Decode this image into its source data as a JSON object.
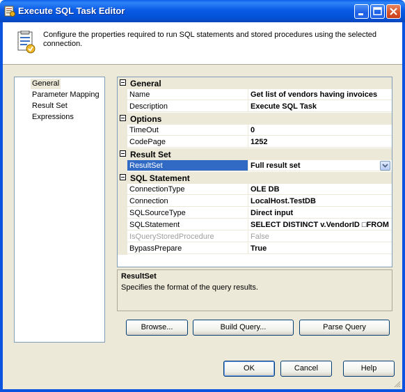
{
  "window": {
    "title": "Execute SQL Task Editor"
  },
  "header": {
    "description": "Configure the properties required to run SQL statements and stored procedures using the selected connection."
  },
  "nav": {
    "items": [
      {
        "label": "General",
        "selected": true
      },
      {
        "label": "Parameter Mapping",
        "selected": false
      },
      {
        "label": "Result Set",
        "selected": false
      },
      {
        "label": "Expressions",
        "selected": false
      }
    ]
  },
  "properties": {
    "categories": {
      "general": "General",
      "options": "Options",
      "result_set": "Result Set",
      "sql_statement": "SQL Statement"
    },
    "rows": {
      "name": {
        "label": "Name",
        "value": "Get list of vendors having invoices"
      },
      "description": {
        "label": "Description",
        "value": "Execute SQL Task"
      },
      "timeout": {
        "label": "TimeOut",
        "value": "0"
      },
      "codepage": {
        "label": "CodePage",
        "value": "1252"
      },
      "resultset": {
        "label": "ResultSet",
        "value": "Full result set"
      },
      "connectiontype": {
        "label": "ConnectionType",
        "value": "OLE DB"
      },
      "connection": {
        "label": "Connection",
        "value": "LocalHost.TestDB"
      },
      "sqlsourcetype": {
        "label": "SQLSourceType",
        "value": "Direct input"
      },
      "sqlstatement": {
        "label": "SQLStatement",
        "value": "SELECT DISTINCT v.VendorID □FROM"
      },
      "isquerystoredprocedure": {
        "label": "IsQueryStoredProcedure",
        "value": "False"
      },
      "bypassprepare": {
        "label": "BypassPrepare",
        "value": "True"
      }
    }
  },
  "description_panel": {
    "title": "ResultSet",
    "text": "Specifies the format of the query results."
  },
  "buttons": {
    "browse": "Browse...",
    "build_query": "Build Query...",
    "parse_query": "Parse Query",
    "ok": "OK",
    "cancel": "Cancel",
    "help": "Help"
  }
}
